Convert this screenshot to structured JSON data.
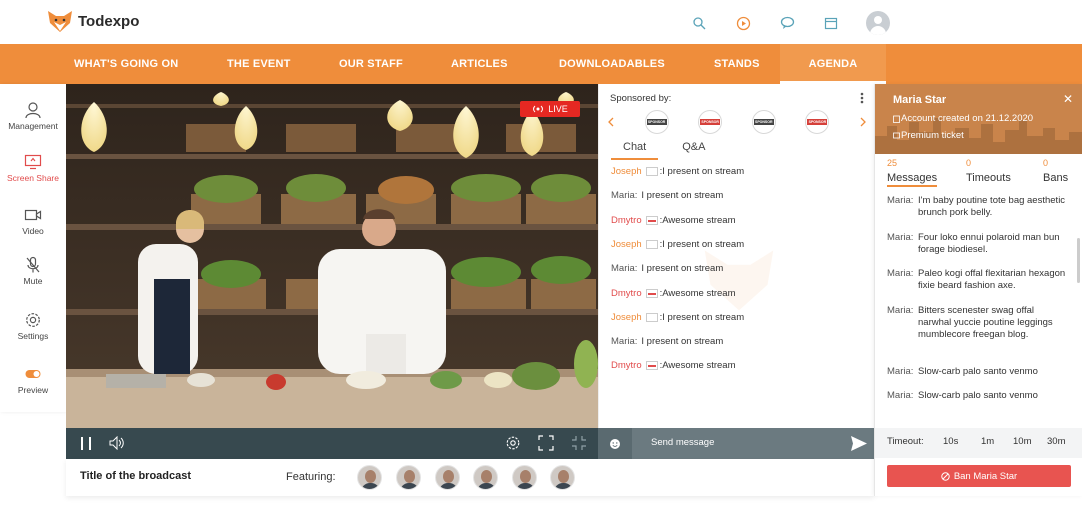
{
  "app": {
    "name": "Todexpo"
  },
  "header_icons": [
    "search-icon",
    "play-icon",
    "chat-icon",
    "calendar-icon",
    "user-avatar"
  ],
  "nav": {
    "items": [
      "WHAT'S GOING ON",
      "THE EVENT",
      "OUR STAFF",
      "ARTICLES",
      "DOWNLOADABLES",
      "STANDS",
      "AGENDA"
    ],
    "active": "AGENDA"
  },
  "sidebar": {
    "items": [
      {
        "label": "Management",
        "icon": "user-icon"
      },
      {
        "label": "Screen Share",
        "icon": "screen-share-icon"
      },
      {
        "label": "Video",
        "icon": "video-icon"
      },
      {
        "label": "Mute",
        "icon": "mic-off-icon"
      },
      {
        "label": "Settings",
        "icon": "gear-icon"
      },
      {
        "label": "Preview",
        "icon": "toggle-icon"
      }
    ]
  },
  "video": {
    "live_label": "LIVE"
  },
  "chat": {
    "sponsored_label": "Sponsored by:",
    "sponsor_badge": "SPONSOR",
    "tabs": [
      "Chat",
      "Q&A"
    ],
    "active_tab": "Chat",
    "messages": [
      {
        "name": "Joseph",
        "color": "#ef8d3b",
        "flag": "plain",
        "text": "I present on stream"
      },
      {
        "name": "Maria:",
        "color": "#555555",
        "flag": "none",
        "text": "I present on stream"
      },
      {
        "name": "Dmytro",
        "color": "#e14b4b",
        "flag": "red",
        "text": "Awesome stream"
      },
      {
        "name": "Joseph",
        "color": "#ef8d3b",
        "flag": "plain",
        "text": "I present on stream"
      },
      {
        "name": "Maria:",
        "color": "#555555",
        "flag": "none",
        "text": "I present on stream"
      },
      {
        "name": "Dmytro",
        "color": "#e14b4b",
        "flag": "red",
        "text": "Awesome stream"
      },
      {
        "name": "Joseph",
        "color": "#ef8d3b",
        "flag": "plain",
        "text": "I present on stream"
      },
      {
        "name": "Maria:",
        "color": "#555555",
        "flag": "none",
        "text": "I present on stream"
      },
      {
        "name": "Dmytro",
        "color": "#e14b4b",
        "flag": "red",
        "text": "Awesome stream"
      }
    ],
    "input_placeholder": "Send message"
  },
  "broadcast": {
    "title": "Title of the broadcast",
    "featuring_label": "Featuring:",
    "featured_count": 6
  },
  "profile": {
    "name": "Maria Star",
    "account_created": "Account created on 21.12.2020",
    "ticket": "Premium ticket",
    "stats": [
      {
        "value": "25",
        "label": "Messages"
      },
      {
        "value": "0",
        "label": "Timeouts"
      },
      {
        "value": "0",
        "label": "Bans"
      }
    ],
    "active_stat": "Messages",
    "messages": [
      {
        "who": "Maria:",
        "text": "I'm baby poutine tote bag aesthetic brunch pork belly."
      },
      {
        "who": "Maria:",
        "text": "Four loko ennui polaroid man bun forage biodiesel."
      },
      {
        "who": "Maria:",
        "text": "Paleo kogi offal flexitarian hexagon fixie beard fashion axe."
      },
      {
        "who": "Maria:",
        "text": "Bitters scenester swag offal narwhal yuccie poutine leggings mumblecore freegan blog."
      },
      {
        "who": "Maria:",
        "text": "Slow-carb palo santo venmo"
      },
      {
        "who": "Maria:",
        "text": "Slow-carb palo santo venmo"
      }
    ],
    "timeout_label": "Timeout:",
    "timeout_options": [
      "10s",
      "1m",
      "10m",
      "30m"
    ],
    "ban_label": "Ban Maria Star"
  },
  "colors": {
    "accent": "#ef8d3b",
    "danger": "#e85450",
    "live": "#e52822"
  }
}
